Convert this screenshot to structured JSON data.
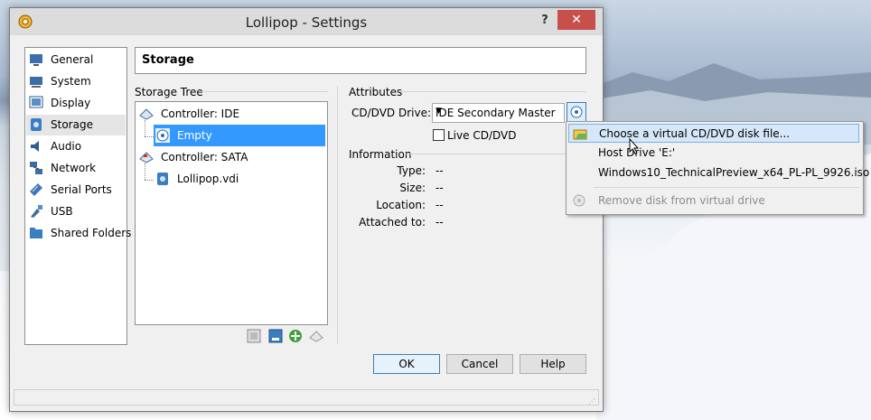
{
  "window": {
    "title": "Lollipop - Settings",
    "help_label": "?",
    "close_label": "✕"
  },
  "nav": {
    "items": [
      {
        "label": "General",
        "icon": "general-icon"
      },
      {
        "label": "System",
        "icon": "system-icon"
      },
      {
        "label": "Display",
        "icon": "display-icon"
      },
      {
        "label": "Storage",
        "icon": "storage-icon",
        "selected": true
      },
      {
        "label": "Audio",
        "icon": "audio-icon"
      },
      {
        "label": "Network",
        "icon": "network-icon"
      },
      {
        "label": "Serial Ports",
        "icon": "serial-ports-icon"
      },
      {
        "label": "USB",
        "icon": "usb-icon"
      },
      {
        "label": "Shared Folders",
        "icon": "shared-folders-icon"
      }
    ]
  },
  "page": {
    "title": "Storage"
  },
  "storage_tree": {
    "label": "Storage Tree",
    "rows": [
      {
        "label": "Controller: IDE"
      },
      {
        "label": "Empty"
      },
      {
        "label": "Controller: SATA"
      },
      {
        "label": "Lollipop.vdi"
      }
    ]
  },
  "attributes": {
    "label": "Attributes",
    "drive_label": "CD/DVD Drive:",
    "drive_value": "IDE Secondary Master",
    "live_cd_label": "Live CD/DVD",
    "live_cd_checked": false
  },
  "information": {
    "label": "Information",
    "rows": [
      {
        "label": "Type:",
        "value": "--"
      },
      {
        "label": "Size:",
        "value": "--"
      },
      {
        "label": "Location:",
        "value": "--"
      },
      {
        "label": "Attached to:",
        "value": "--"
      }
    ]
  },
  "buttons": {
    "ok": "OK",
    "cancel": "Cancel",
    "help": "Help"
  },
  "popup_menu": {
    "items": [
      {
        "label": "Choose a virtual CD/DVD disk file...",
        "highlighted": true
      },
      {
        "label": "Host Drive 'E:'"
      },
      {
        "label": "Windows10_TechnicalPreview_x64_PL-PL_9926.iso"
      },
      {
        "label": "Remove disk from virtual drive",
        "disabled": true
      }
    ]
  },
  "colors": {
    "selection": "#3399ff",
    "close": "#c7504a",
    "menu_highlight": "#d5e7f8"
  }
}
